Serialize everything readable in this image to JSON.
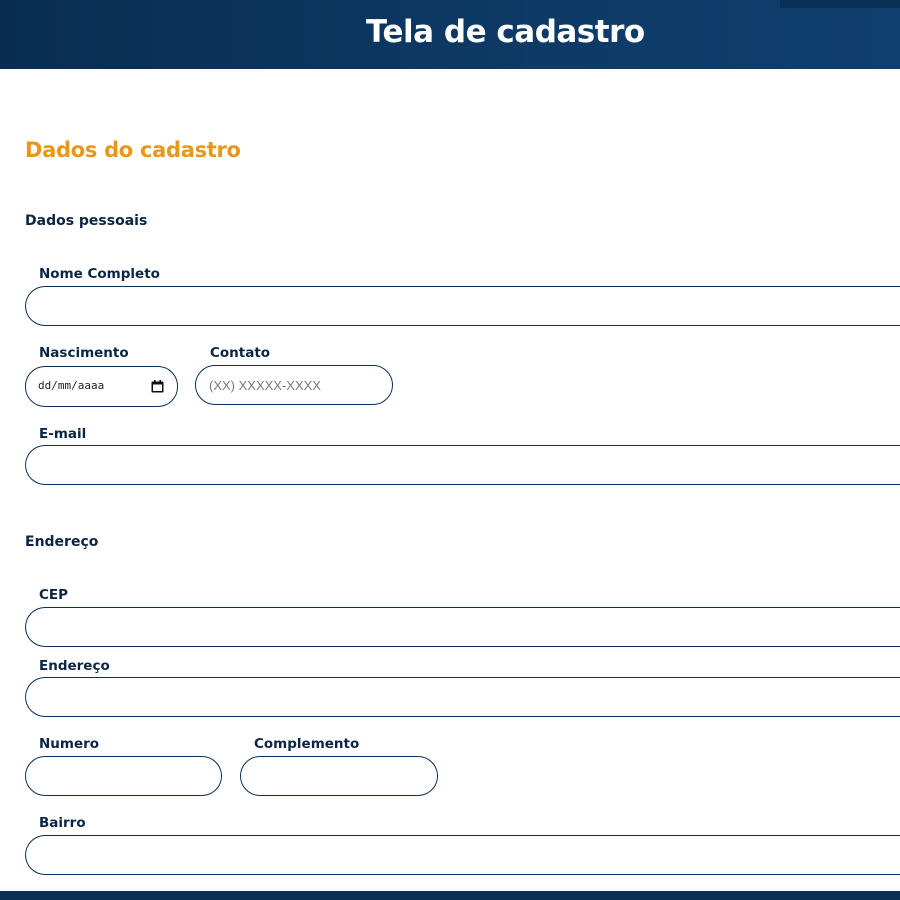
{
  "header": {
    "title": "Tela de cadastro"
  },
  "form": {
    "section_title": "Dados do cadastro",
    "personal": {
      "title": "Dados pessoais",
      "full_name": {
        "label": "Nome Completo",
        "value": "",
        "placeholder": ""
      },
      "birth": {
        "label": "Nascimento",
        "display": "dd/mm/aaaa",
        "icon": "calendar-icon"
      },
      "contact": {
        "label": "Contato",
        "value": "",
        "placeholder": "(XX) XXXXX-XXXX"
      },
      "email": {
        "label": "E-mail",
        "value": "",
        "placeholder": ""
      }
    },
    "address": {
      "title": "Endereço",
      "cep": {
        "label": "CEP",
        "value": "",
        "placeholder": ""
      },
      "street": {
        "label": "Endereço",
        "value": "",
        "placeholder": ""
      },
      "number": {
        "label": "Numero",
        "value": "",
        "placeholder": ""
      },
      "complement": {
        "label": "Complemento",
        "value": "",
        "placeholder": ""
      },
      "district": {
        "label": "Bairro",
        "value": "",
        "placeholder": ""
      }
    }
  },
  "colors": {
    "header_bg": "#0d3a66",
    "primary_text": "#0b2545",
    "accent": "#e9961b",
    "input_border": "#0b2f57"
  }
}
